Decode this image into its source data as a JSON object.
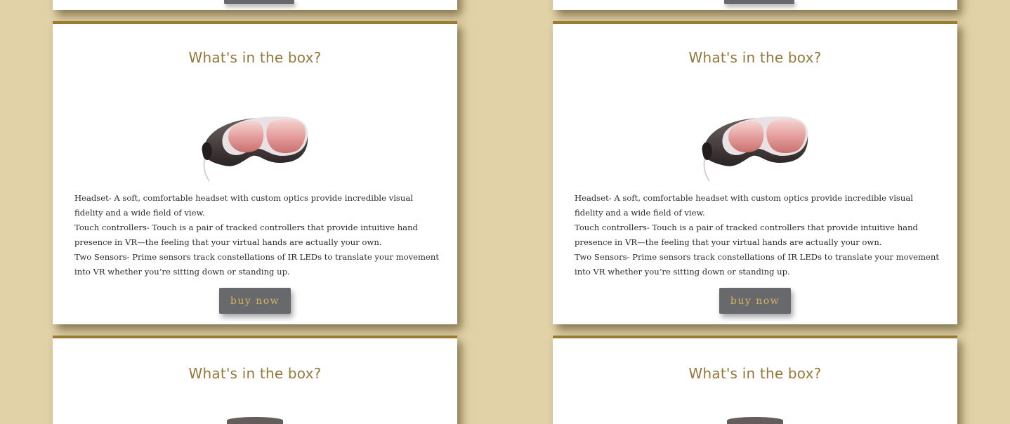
{
  "cards": [
    {
      "title": "What's in the box?",
      "description": [
        "Headset- A soft, comfortable headset with custom optics provide incredible visual fidelity and a wide field of view.",
        "Touch controllers- Touch is a pair of tracked controllers that provide intuitive hand presence in VR—the feeling that your virtual hands are actually your own.",
        "Two Sensors- Prime sensors track constellations of IR LEDs to translate your movement into VR whether you’re sitting down or standing up."
      ],
      "button_label": "buy now"
    },
    {
      "title": "What's in the box?",
      "description": [
        "Headset- A soft, comfortable headset with custom optics provide incredible visual fidelity and a wide field of view.",
        "Touch controllers- Touch is a pair of tracked controllers that provide intuitive hand presence in VR—the feeling that your virtual hands are actually your own.",
        "Two Sensors- Prime sensors track constellations of IR LEDs to translate your movement into VR whether you’re sitting down or standing up."
      ],
      "button_label": "buy now"
    },
    {
      "title": "What's in the box?"
    },
    {
      "title": "What's in the box?"
    }
  ],
  "colors": {
    "page_background": "#e2d2a8",
    "card_border": "#9a7d32",
    "title": "#94773a",
    "button_background": "#67696c",
    "button_text": "#d9b35a"
  },
  "icons": {
    "product_image": "vr-headset-image"
  }
}
